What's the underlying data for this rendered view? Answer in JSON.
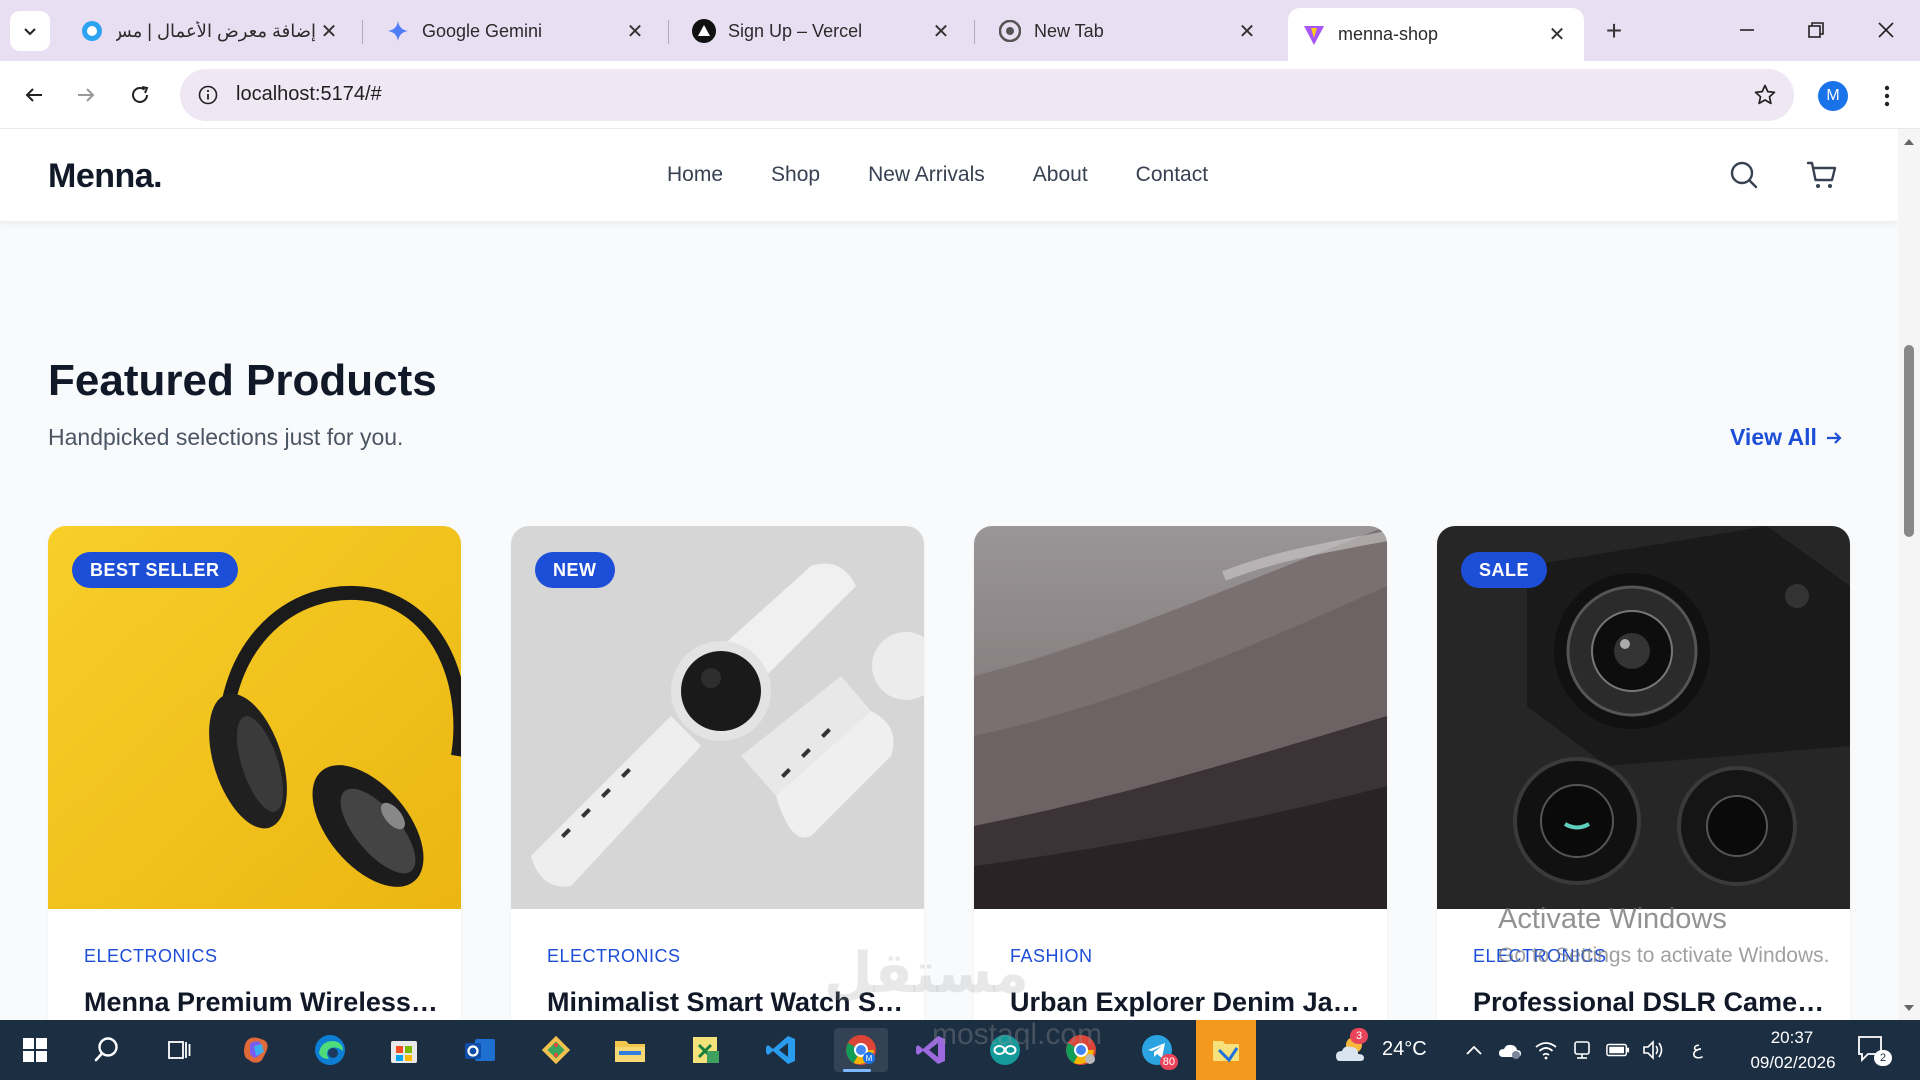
{
  "browser": {
    "tabs": [
      {
        "title": "إضافة معرض الأعمال | مس",
        "icon": "mostaql-icon"
      },
      {
        "title": "Google Gemini",
        "icon": "gemini-icon"
      },
      {
        "title": "Sign Up – Vercel",
        "icon": "vercel-icon"
      },
      {
        "title": "New Tab",
        "icon": "chrome-icon"
      },
      {
        "title": "menna-shop",
        "icon": "vite-icon"
      }
    ],
    "active_tab_index": 4,
    "url": "localhost:5174/#",
    "profile_initial": "M"
  },
  "site": {
    "logo": "Menna.",
    "nav": [
      "Home",
      "Shop",
      "New Arrivals",
      "About",
      "Contact"
    ],
    "accent_color": "#1d4ed8"
  },
  "featured": {
    "title": "Featured Products",
    "subtitle": "Handpicked selections just for you.",
    "view_all": "View All"
  },
  "products": [
    {
      "badge": "BEST SELLER",
      "category": "ELECTRONICS",
      "name": "Menna Premium Wireless Headphones",
      "image": "headphones-image"
    },
    {
      "badge": "NEW",
      "category": "ELECTRONICS",
      "name": "Minimalist Smart Watch Series",
      "image": "smart-watch-image"
    },
    {
      "badge": "",
      "category": "FASHION",
      "name": "Urban Explorer Denim Jacket",
      "image": "foggy-hillside-image"
    },
    {
      "badge": "SALE",
      "category": "ELECTRONICS",
      "name": "Professional DSLR Camera Kit",
      "image": "dslr-camera-image"
    }
  ],
  "os_watermark": {
    "title": "Activate Windows",
    "subtitle": "Go to Settings to activate Windows."
  },
  "site_watermark": {
    "text": "مستقل",
    "sub": "mostaql.com"
  },
  "taskbar": {
    "weather": "24°C",
    "language": "ع",
    "time": "20:37",
    "date": "09/02/2026",
    "notification_count": "2",
    "copilot_badge": "3",
    "telegram_badge": "80"
  }
}
